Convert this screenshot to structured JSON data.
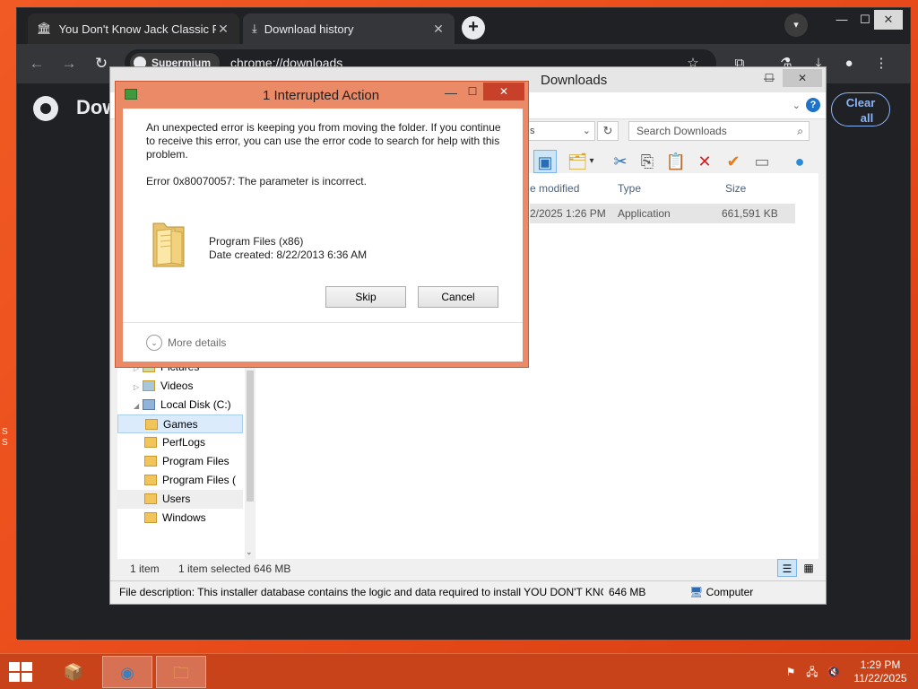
{
  "desktop": {
    "edge_text": [
      "S",
      "S"
    ]
  },
  "chrome": {
    "tabs": [
      {
        "title": "You Don't Know Jack Classic Pa",
        "close": "✕"
      },
      {
        "title": "Download history",
        "close": "✕"
      }
    ],
    "new_tab": "+",
    "tab_menu": "▾",
    "window_buttons": {
      "minimize": "—",
      "maximize": "☐",
      "close": "✕"
    },
    "nav": {
      "back": "←",
      "forward": "→",
      "reload": "↻"
    },
    "site_chip": "Supermium",
    "url": "chrome://downloads",
    "page": {
      "title": "Dow",
      "clear_all_line1": "Clear",
      "clear_all_line2": "all"
    }
  },
  "explorer": {
    "title": "Downloads",
    "address_drop": "s",
    "search_placeholder": "Search Downloads",
    "columns": {
      "modified": "e modified",
      "type": "Type",
      "size": "Size"
    },
    "rows": [
      {
        "modified": "2/2025 1:26 PM",
        "type": "Application",
        "size": "661,591 KB"
      }
    ],
    "nav_items": [
      {
        "label": "Pictures"
      },
      {
        "label": "Videos"
      },
      {
        "label": "Local Disk (C:)"
      },
      {
        "label": "Games"
      },
      {
        "label": "PerfLogs"
      },
      {
        "label": "Program Files"
      },
      {
        "label": "Program Files ("
      },
      {
        "label": "Users"
      },
      {
        "label": "Windows"
      }
    ],
    "status": {
      "count": "1 item",
      "selected": "1 item selected",
      "selected_size": "646 MB"
    },
    "description": {
      "text": "File description: This installer database contains the logic and data required to install YOU DON'T KNOW",
      "size": "646 MB",
      "location": "Computer"
    }
  },
  "dialog": {
    "title": "1 Interrupted Action",
    "message": "An unexpected error is keeping you from moving the folder. If you continue to receive this error, you can use the error code to search for help with this problem.",
    "error": "Error 0x80070057: The parameter is incorrect.",
    "item_name": "Program Files (x86)",
    "item_date": "Date created: 8/22/2013 6:36 AM",
    "skip": "Skip",
    "cancel": "Cancel",
    "more_details": "More details"
  },
  "taskbar": {
    "time": "1:29 PM",
    "date": "11/22/2025"
  },
  "colors": {
    "dialog_frame": "#ea8a67",
    "dialog_close": "#c7402a",
    "taskbar": "#c9431a",
    "chrome_bg": "#202124",
    "accent_blue": "#8ab4f8"
  }
}
